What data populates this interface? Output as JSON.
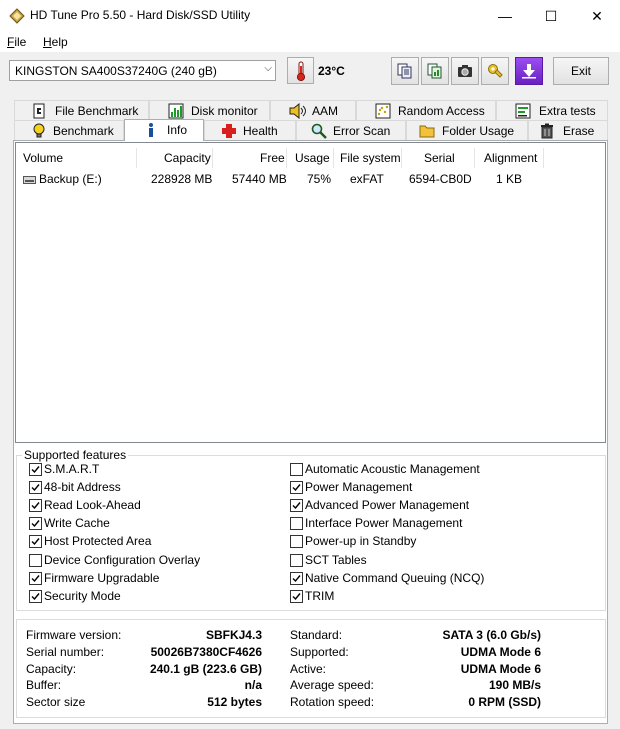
{
  "window": {
    "title": "HD Tune Pro 5.50 - Hard Disk/SSD Utility",
    "minimize": "—",
    "maximize": "☐",
    "close": "✕"
  },
  "menu": {
    "file": "File",
    "help": "Help"
  },
  "toolbar": {
    "drive": "KINGSTON SA400S37240G (240 gB)",
    "dropdown_arrow": "⌵",
    "temperature": "23°C",
    "exit_label": "Exit"
  },
  "tabs": {
    "row1": [
      {
        "label": "File Benchmark",
        "icon": "file-benchmark-icon"
      },
      {
        "label": "Disk monitor",
        "icon": "disk-monitor-icon"
      },
      {
        "label": "AAM",
        "icon": "speaker-icon"
      },
      {
        "label": "Random Access",
        "icon": "random-access-icon"
      },
      {
        "label": "Extra tests",
        "icon": "extra-tests-icon"
      }
    ],
    "row2": [
      {
        "label": "Benchmark",
        "icon": "lightbulb-icon"
      },
      {
        "label": "Info",
        "icon": "info-icon",
        "active": true
      },
      {
        "label": "Health",
        "icon": "health-cross-icon"
      },
      {
        "label": "Error Scan",
        "icon": "magnifier-icon"
      },
      {
        "label": "Folder Usage",
        "icon": "folder-icon"
      },
      {
        "label": "Erase",
        "icon": "trash-icon"
      }
    ]
  },
  "volumes": {
    "columns": [
      "Volume",
      "Capacity",
      "Free",
      "Usage",
      "File system",
      "Serial",
      "Alignment"
    ],
    "rows": [
      {
        "volume": "Backup (E:)",
        "capacity": "228928 MB",
        "free": "57440 MB",
        "usage": "75%",
        "filesystem": "exFAT",
        "serial": "6594-CB0D",
        "alignment": "1 KB"
      }
    ]
  },
  "features": {
    "legend": "Supported features",
    "left": [
      {
        "label": "S.M.A.R.T",
        "checked": true
      },
      {
        "label": "48-bit Address",
        "checked": true
      },
      {
        "label": "Read Look-Ahead",
        "checked": true
      },
      {
        "label": "Write Cache",
        "checked": true
      },
      {
        "label": "Host Protected Area",
        "checked": true
      },
      {
        "label": "Device Configuration Overlay",
        "checked": false
      },
      {
        "label": "Firmware Upgradable",
        "checked": true
      },
      {
        "label": "Security Mode",
        "checked": true
      }
    ],
    "right": [
      {
        "label": "Automatic Acoustic Management",
        "checked": false
      },
      {
        "label": "Power Management",
        "checked": true
      },
      {
        "label": "Advanced Power Management",
        "checked": true
      },
      {
        "label": "Interface Power Management",
        "checked": false
      },
      {
        "label": "Power-up in Standby",
        "checked": false
      },
      {
        "label": "SCT Tables",
        "checked": false
      },
      {
        "label": "Native Command Queuing (NCQ)",
        "checked": true
      },
      {
        "label": "TRIM",
        "checked": true
      }
    ]
  },
  "info": {
    "left": [
      {
        "label": "Firmware version:",
        "value": "SBFKJ4.3"
      },
      {
        "label": "Serial number:",
        "value": "50026B7380CF4626"
      },
      {
        "label": "Capacity:",
        "value": "240.1 gB (223.6 GB)"
      },
      {
        "label": "Buffer:",
        "value": "n/a"
      },
      {
        "label": "Sector size",
        "value": "512 bytes"
      }
    ],
    "right": [
      {
        "label": "Standard:",
        "value": "SATA 3 (6.0 Gb/s)"
      },
      {
        "label": "Supported:",
        "value": "UDMA Mode 6"
      },
      {
        "label": "Active:",
        "value": "UDMA Mode 6"
      },
      {
        "label": "Average speed:",
        "value": "190 MB/s"
      },
      {
        "label": "Rotation speed:",
        "value": "0 RPM (SSD)"
      }
    ]
  },
  "colors": {
    "accent_purple": "#7b2fd6",
    "thermometer_red": "#d9261c",
    "check": "#000000"
  }
}
